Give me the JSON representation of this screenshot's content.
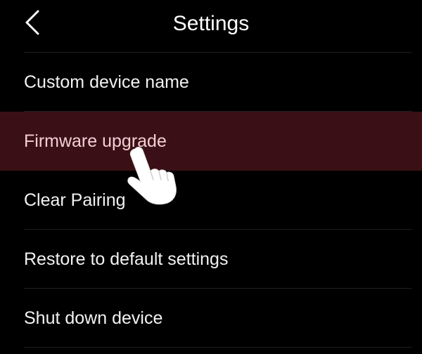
{
  "header": {
    "title": "Settings",
    "back_icon": "chevron-left-icon"
  },
  "settings": {
    "items": [
      {
        "label": "Custom device name",
        "highlighted": false
      },
      {
        "label": "Firmware upgrade",
        "highlighted": true
      },
      {
        "label": "Clear Pairing",
        "highlighted": false
      },
      {
        "label": "Restore to default settings",
        "highlighted": false
      },
      {
        "label": "Shut down device",
        "highlighted": false
      }
    ]
  },
  "overlay": {
    "icon": "hand-pointer-icon"
  },
  "colors": {
    "background": "#000000",
    "highlight": "#3a1016",
    "highlight_text": "#f3cfd4",
    "text": "#f2f2f2"
  }
}
